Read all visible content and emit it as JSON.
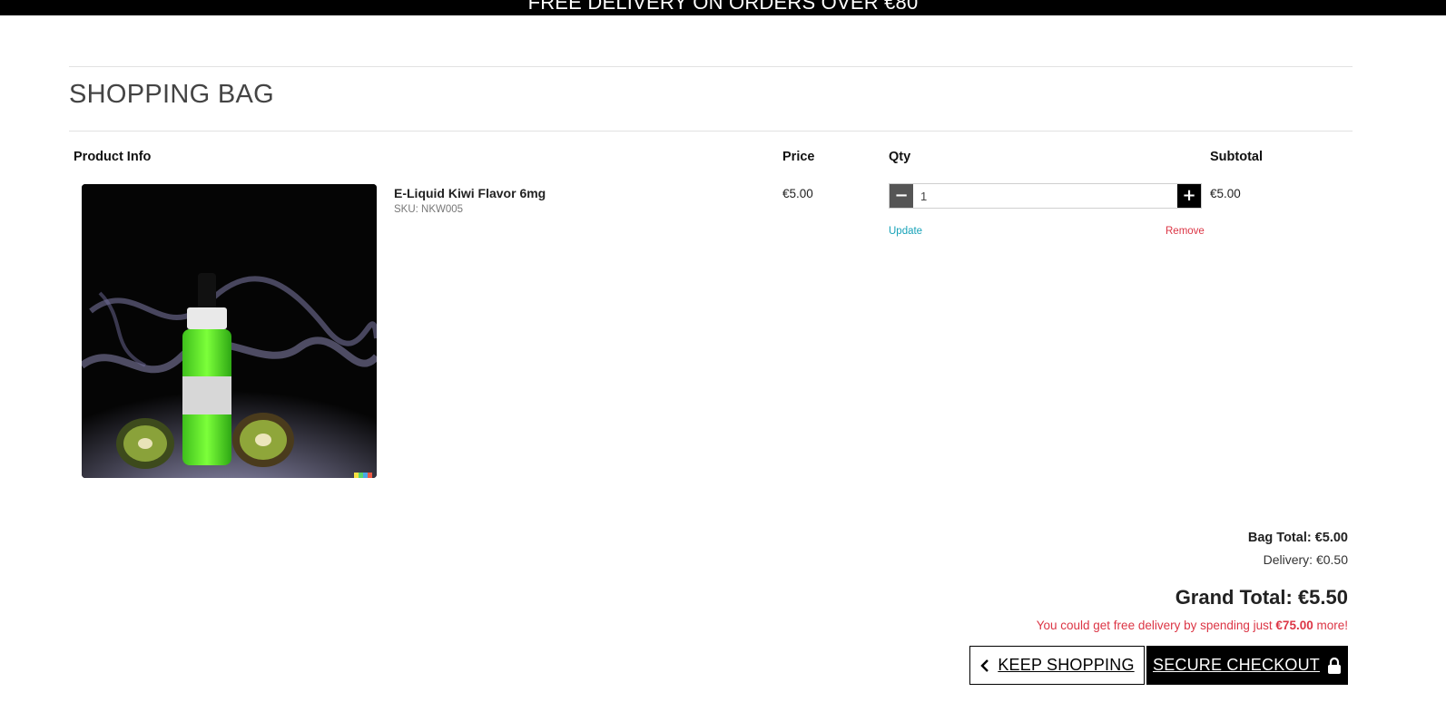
{
  "banner": {
    "text": "FREE DELIVERY ON ORDERS OVER €80"
  },
  "page": {
    "title": "SHOPPING BAG"
  },
  "table": {
    "headers": {
      "product": "Product Info",
      "price": "Price",
      "qty": "Qty",
      "subtotal": "Subtotal"
    }
  },
  "item": {
    "name": "E-Liquid Kiwi Flavor 6mg",
    "sku": "SKU: NKW005",
    "price": "€5.00",
    "qty": "1",
    "subtotal": "€5.00",
    "update_label": "Update",
    "remove_label": "Remove",
    "decrement_symbol": "−",
    "increment_symbol": "+"
  },
  "summary": {
    "bag_total": "Bag Total: €5.00",
    "delivery": "Delivery: €0.50",
    "grand_total": "Grand Total: €5.50",
    "free_delivery_prefix": "You could get free delivery by spending just",
    "free_delivery_amount": "€75.00",
    "free_delivery_suffix": "more!"
  },
  "buttons": {
    "keep_shopping": "KEEP SHOPPING",
    "secure_checkout": "SECURE CHECKOUT"
  },
  "icons": {
    "keep_shopping": "chevron-left-icon",
    "secure_checkout": "lock-icon"
  },
  "colors": {
    "update_link": "#17a2b8",
    "remove_link": "#dc3545",
    "free_note": "#dc3545"
  }
}
